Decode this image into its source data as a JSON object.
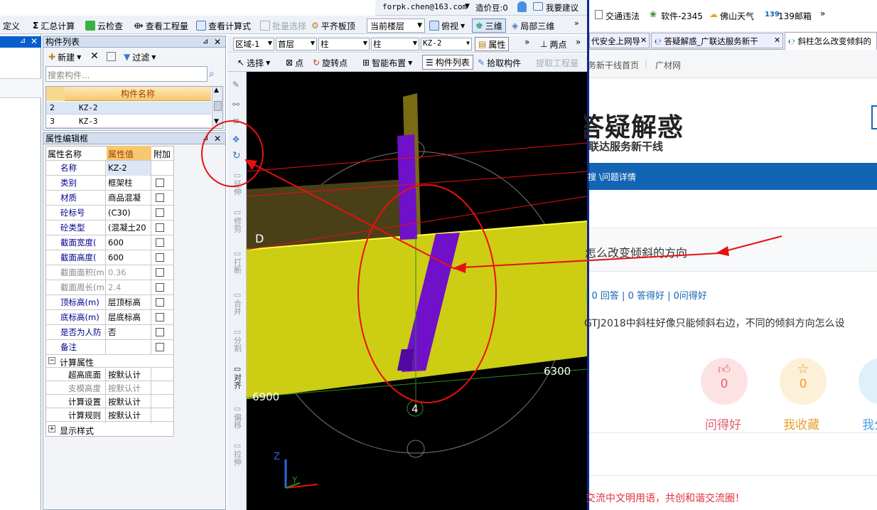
{
  "top_toolbar": {
    "define": "定义",
    "summary_calc": "汇总计算",
    "cloud_check": "云检查",
    "view_quantity": "查看工程量",
    "view_formula": "查看计算式",
    "batch_select": "批量选择",
    "flat_slab_top": "平齐板顶",
    "current_floor": "当前楼层",
    "top_view": "俯视",
    "three_d": "三维",
    "local_3d": "局部三维",
    "account": "forpk.chen@163.com",
    "price_beans": "造价豆:0",
    "suggest": "我要建议"
  },
  "component_list": {
    "title": "构件列表",
    "new_btn": "新建",
    "filter_btn": "过滤",
    "search_placeholder": "搜索构件...",
    "col_header": "构件名称",
    "rows": [
      {
        "num": "2",
        "name": "KZ-2"
      },
      {
        "num": "3",
        "name": "KZ-3"
      }
    ]
  },
  "property_editor": {
    "title": "属性编辑框",
    "col_name": "属性名称",
    "col_value": "属性值",
    "col_extra": "附加",
    "rows": [
      {
        "name": "名称",
        "value": "KZ-2"
      },
      {
        "name": "类别",
        "value": "框架柱"
      },
      {
        "name": "材质",
        "value": "商品混凝"
      },
      {
        "name": "砼标号",
        "value": "(C30)"
      },
      {
        "name": "砼类型",
        "value": "(混凝土20"
      },
      {
        "name": "截面宽度(",
        "value": "600"
      },
      {
        "name": "截面高度(",
        "value": "600"
      },
      {
        "name": "截面面积(m",
        "value": "0.36"
      },
      {
        "name": "截面周长(m",
        "value": "2.4"
      },
      {
        "name": "顶标高(m)",
        "value": "层顶标高"
      },
      {
        "name": "底标高(m)",
        "value": "层底标高"
      },
      {
        "name": "是否为人防",
        "value": "否"
      },
      {
        "name": "备注",
        "value": ""
      }
    ],
    "calc_group": "计算属性",
    "calc_rows": [
      {
        "name": "超高底面",
        "value": "按默认计"
      },
      {
        "name": "支模高度",
        "value": "按默认计"
      },
      {
        "name": "计算设置",
        "value": "按默认计"
      },
      {
        "name": "计算规则",
        "value": "按默认计"
      }
    ],
    "display_group": "显示样式"
  },
  "cad_toolbar": {
    "region": "区域-1",
    "floor": "首层",
    "type1": "柱",
    "type2": "柱",
    "component": "KZ-2",
    "attributes": "属性",
    "two_points": "两点",
    "select": "选择",
    "point": "点",
    "rotate_point": "旋转点",
    "smart_layout": "智能布置",
    "component_list_btn": "构件列表",
    "pick_component": "拾取构件",
    "extract_qty": "提取工程量"
  },
  "side_tools": [
    "延伸",
    "修剪",
    "打断",
    "合并",
    "分割",
    "对齐",
    "偏移",
    "拉伸"
  ],
  "viewport": {
    "dim_left": "6900",
    "dim_right": "6300",
    "axis_4": "4",
    "axis_d": "D",
    "axis_z": "Z",
    "axis_y": "Y"
  },
  "browser": {
    "bookmarks": [
      "交通违法",
      "软件-2345",
      "佛山天气",
      "139邮箱"
    ],
    "tabs": [
      "代安全上网导",
      "答疑解惑_广联达服务新干",
      "斜柱怎么改变倾斜的"
    ],
    "nav_links": [
      "务新干线首页",
      "广材网"
    ],
    "logo_title": "答疑解惑",
    "logo_sub": "联达服务新干线",
    "breadcrumb": "搜 \\问题详情",
    "question_title": "怎么改变倾斜的方向",
    "stats": "| 0 回答 | 0 答得好 | 0问得好",
    "question_body": "GTJ2018中斜柱好像只能倾斜右边，不同的倾斜方向怎么设",
    "like_count": "0",
    "like_label": "问得好",
    "fav_count": "0",
    "fav_label": "我收藏",
    "share_label": "我分",
    "footer_note": "交流中文明用语，共创和谐交流圈！"
  },
  "colors": {
    "accent_blue": "#1464b4",
    "beam_yellow": "#cdcd14",
    "column_purple": "#7010c8",
    "annotation_red": "#e81010"
  }
}
